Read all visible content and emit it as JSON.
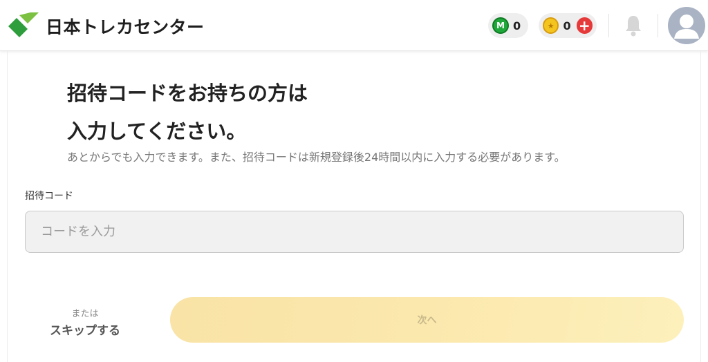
{
  "header": {
    "logo_text": "日本トレカセンター",
    "m_points": {
      "icon_letter": "M",
      "value": "0"
    },
    "coins": {
      "value": "0",
      "add_symbol": "+"
    }
  },
  "main": {
    "title_line1": "招待コードをお持ちの方は",
    "title_line2": "入力してください。",
    "subtitle": "あとからでも入力できます。また、招待コードは新規登録後24時間以内に入力する必要があります。",
    "code_field": {
      "label": "招待コード",
      "placeholder": "コードを入力",
      "value": ""
    },
    "skip": {
      "small": "または",
      "big": "スキップする"
    },
    "next_button": "次へ"
  },
  "colors": {
    "brand_green": "#2e9e3c",
    "next_button_bg": "#fbe8ad",
    "m_icon": "#1fa83a",
    "coin": "#f5c51f",
    "add_red": "#e63a3a"
  },
  "icons": [
    "logo-mark-icon",
    "m-point-icon",
    "coin-icon",
    "plus-icon",
    "bell-icon",
    "avatar-icon"
  ]
}
